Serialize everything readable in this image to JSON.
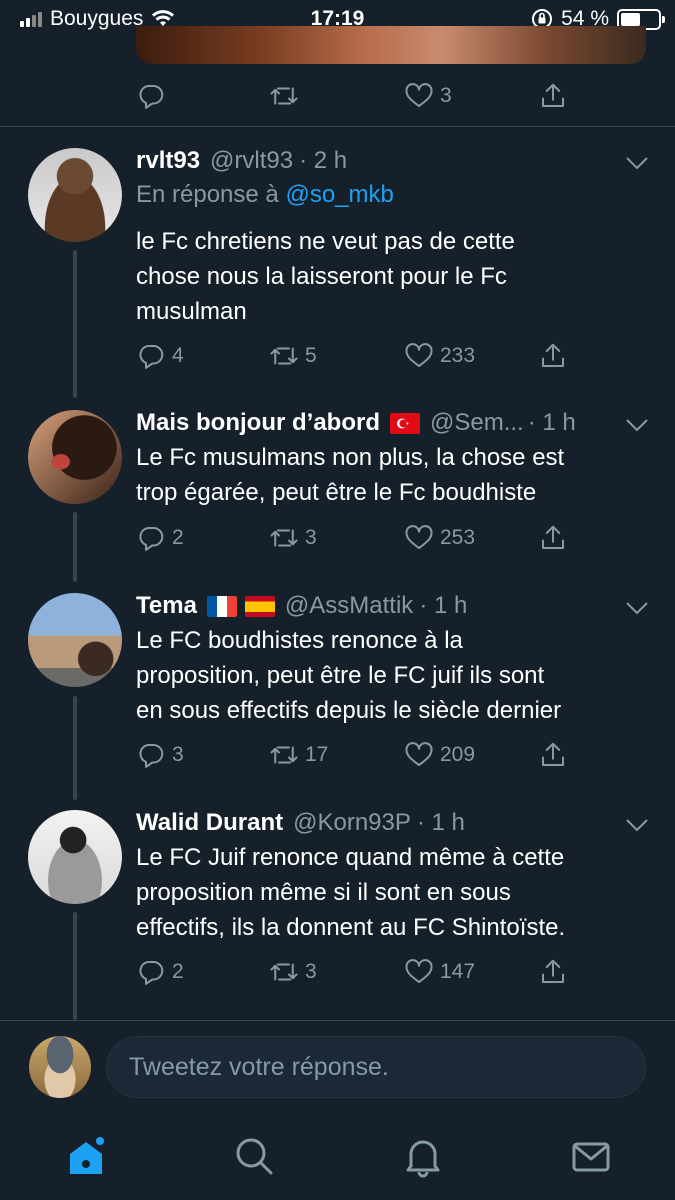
{
  "status_bar": {
    "carrier": "Bouygues",
    "time": "17:19",
    "battery": "54 %",
    "battery_level": 0.54
  },
  "previous_tweet": {
    "likes": "3"
  },
  "tweets": [
    {
      "name": "rvlt93",
      "handle": "@rvlt93",
      "time": "· 2 h",
      "reply_prefix": "En réponse à",
      "reply_to": "@so_mkb",
      "text_lines": [
        "le Fc chretiens ne veut pas de cette",
        "chose nous la laisseront pour le Fc",
        "musulman"
      ],
      "replies": "4",
      "retweets": "5",
      "likes": "233"
    },
    {
      "name": "Mais bonjour d’abord",
      "handle": "@Sem...",
      "time": "· 1 h",
      "text_lines": [
        "Le Fc musulmans non plus, la chose est",
        "trop égarée, peut être le Fc boudhiste"
      ],
      "replies": "2",
      "retweets": "3",
      "likes": "253"
    },
    {
      "name": "Tema",
      "handle": "@AssMattik",
      "time": "· 1 h",
      "text_lines": [
        "Le FC boudhistes renonce à la",
        "proposition, peut être le FC juif ils sont",
        "en sous effectifs depuis le siècle dernier"
      ],
      "replies": "3",
      "retweets": "17",
      "likes": "209"
    },
    {
      "name": "Walid Durant",
      "handle": "@Korn93P",
      "time": "· 1 h",
      "text_lines": [
        "Le FC Juif renonce quand même à cette",
        "proposition même si il sont en sous",
        "effectifs, ils la donnent au FC Shintoïste."
      ],
      "replies": "2",
      "retweets": "3",
      "likes": "147"
    }
  ],
  "composer": {
    "placeholder": "Tweetez votre réponse."
  },
  "colors": {
    "background": "#15202b",
    "secondary_text": "#8899a6",
    "accent": "#1da1f2",
    "divider": "#38444d"
  },
  "tabs": [
    "home-icon",
    "search-icon",
    "notifications-icon",
    "messages-icon"
  ]
}
